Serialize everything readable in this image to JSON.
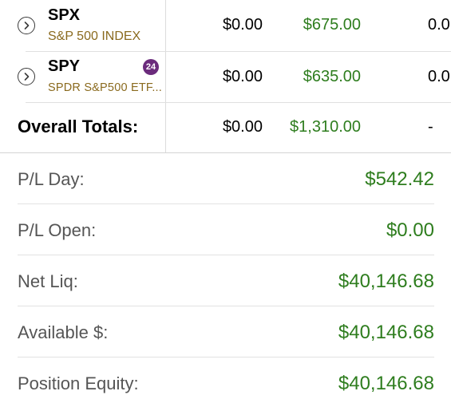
{
  "positions": [
    {
      "symbol": "SPX",
      "description": "S&P 500 INDEX",
      "badge": "",
      "col1": "$0.00",
      "col2": "$675.00",
      "col3": "0.0"
    },
    {
      "symbol": "SPY",
      "description": "SPDR S&P500 ETF...",
      "badge": "24",
      "col1": "$0.00",
      "col2": "$635.00",
      "col3": "0.0"
    }
  ],
  "totals": {
    "label": "Overall Totals:",
    "col1": "$0.00",
    "col2": "$1,310.00",
    "col3": "-"
  },
  "summary": [
    {
      "label": "P/L Day:",
      "value": "$542.42"
    },
    {
      "label": "P/L Open:",
      "value": "$0.00"
    },
    {
      "label": "Net Liq:",
      "value": "$40,146.68"
    },
    {
      "label": "Available $:",
      "value": "$40,146.68"
    },
    {
      "label": "Position Equity:",
      "value": "$40,146.68"
    }
  ],
  "colors": {
    "gain": "#2e7d1e",
    "description": "#8a6a1e",
    "badge": "#6b2b7c"
  },
  "icons": {
    "expand": "chevron-right-circle-icon"
  }
}
